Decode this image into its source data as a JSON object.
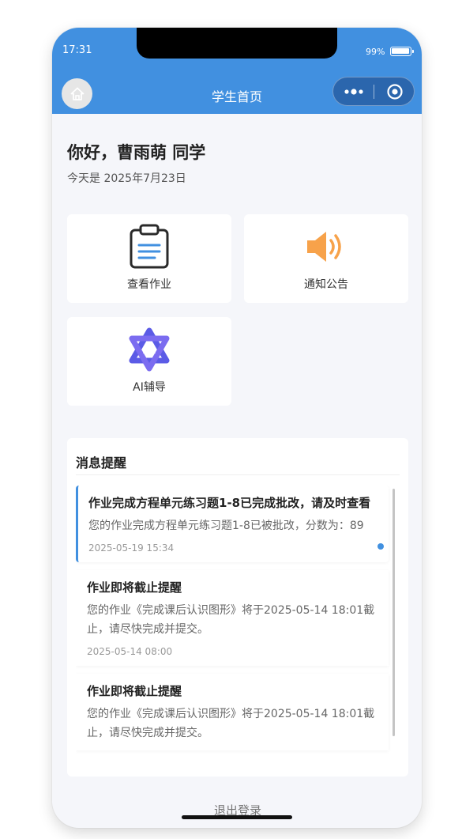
{
  "status_bar": {
    "time": "17:31",
    "battery": "99%",
    "battery_level": 0.99
  },
  "nav": {
    "title": "学生首页"
  },
  "greeting": {
    "title": "你好，曹雨萌 同学",
    "date": "今天是 2025年7月23日"
  },
  "quick_actions": [
    {
      "label": "查看作业",
      "icon": "clipboard-icon"
    },
    {
      "label": "通知公告",
      "icon": "speaker-icon"
    },
    {
      "label": "AI辅导",
      "icon": "ai-logo-icon"
    }
  ],
  "messages": {
    "title": "消息提醒",
    "items": [
      {
        "title": "作业完成方程单元练习题1-8已完成批改，请及时查看",
        "body": "您的作业完成方程单元练习题1-8已被批改，分数为：89",
        "time": "2025-05-19 15:34",
        "unread": true
      },
      {
        "title": "作业即将截止提醒",
        "body": "您的作业《完成课后认识图形》将于2025-05-14 18:01截止，请尽快完成并提交。",
        "time": "2025-05-14 08:00",
        "unread": false
      },
      {
        "title": "作业即将截止提醒",
        "body": "您的作业《完成课后认识图形》将于2025-05-14 18:01截止，请尽快完成并提交。",
        "time": "",
        "unread": false
      }
    ]
  },
  "footer": {
    "logout": "退出登录"
  },
  "colors": {
    "primary": "#4190e0",
    "capsule": "#2b66ad",
    "speaker": "#f7a24a",
    "ai_logo": "#5b5be6"
  }
}
